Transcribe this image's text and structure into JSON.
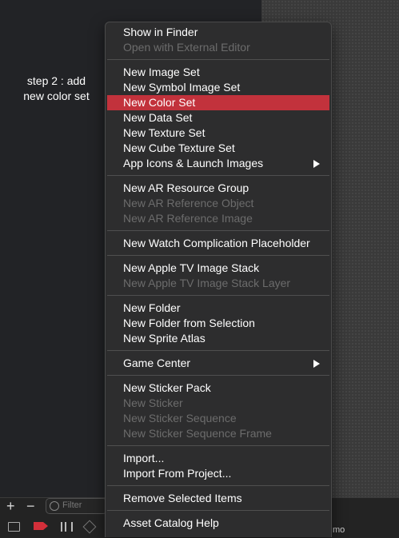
{
  "annotation": {
    "line1": "step 2 : add",
    "line2": "new color set"
  },
  "bottom_bar": {
    "plus": "+",
    "minus": "−",
    "filter_placeholder": "Filter",
    "trailing_text": "mo"
  },
  "menu": {
    "show_in_finder": "Show in Finder",
    "open_external": "Open with External Editor",
    "new_image_set": "New Image Set",
    "new_symbol_image_set": "New Symbol Image Set",
    "new_color_set": "New Color Set",
    "new_data_set": "New Data Set",
    "new_texture_set": "New Texture Set",
    "new_cube_texture_set": "New Cube Texture Set",
    "app_icons": "App Icons & Launch Images",
    "new_ar_group": "New AR Resource Group",
    "new_ar_object": "New AR Reference Object",
    "new_ar_image": "New AR Reference Image",
    "new_watch_placeholder": "New Watch Complication Placeholder",
    "new_tv_stack": "New Apple TV Image Stack",
    "new_tv_stack_layer": "New Apple TV Image Stack Layer",
    "new_folder": "New Folder",
    "new_folder_from_selection": "New Folder from Selection",
    "new_sprite_atlas": "New Sprite Atlas",
    "game_center": "Game Center",
    "new_sticker_pack": "New Sticker Pack",
    "new_sticker": "New Sticker",
    "new_sticker_sequence": "New Sticker Sequence",
    "new_sticker_sequence_frame": "New Sticker Sequence Frame",
    "import": "Import...",
    "import_from_project": "Import From Project...",
    "remove_selected": "Remove Selected Items",
    "asset_catalog_help": "Asset Catalog Help"
  },
  "colors": {
    "highlight": "#c2323c",
    "menu_bg": "#2d2d2e",
    "disabled_text": "#6c6c6c"
  }
}
